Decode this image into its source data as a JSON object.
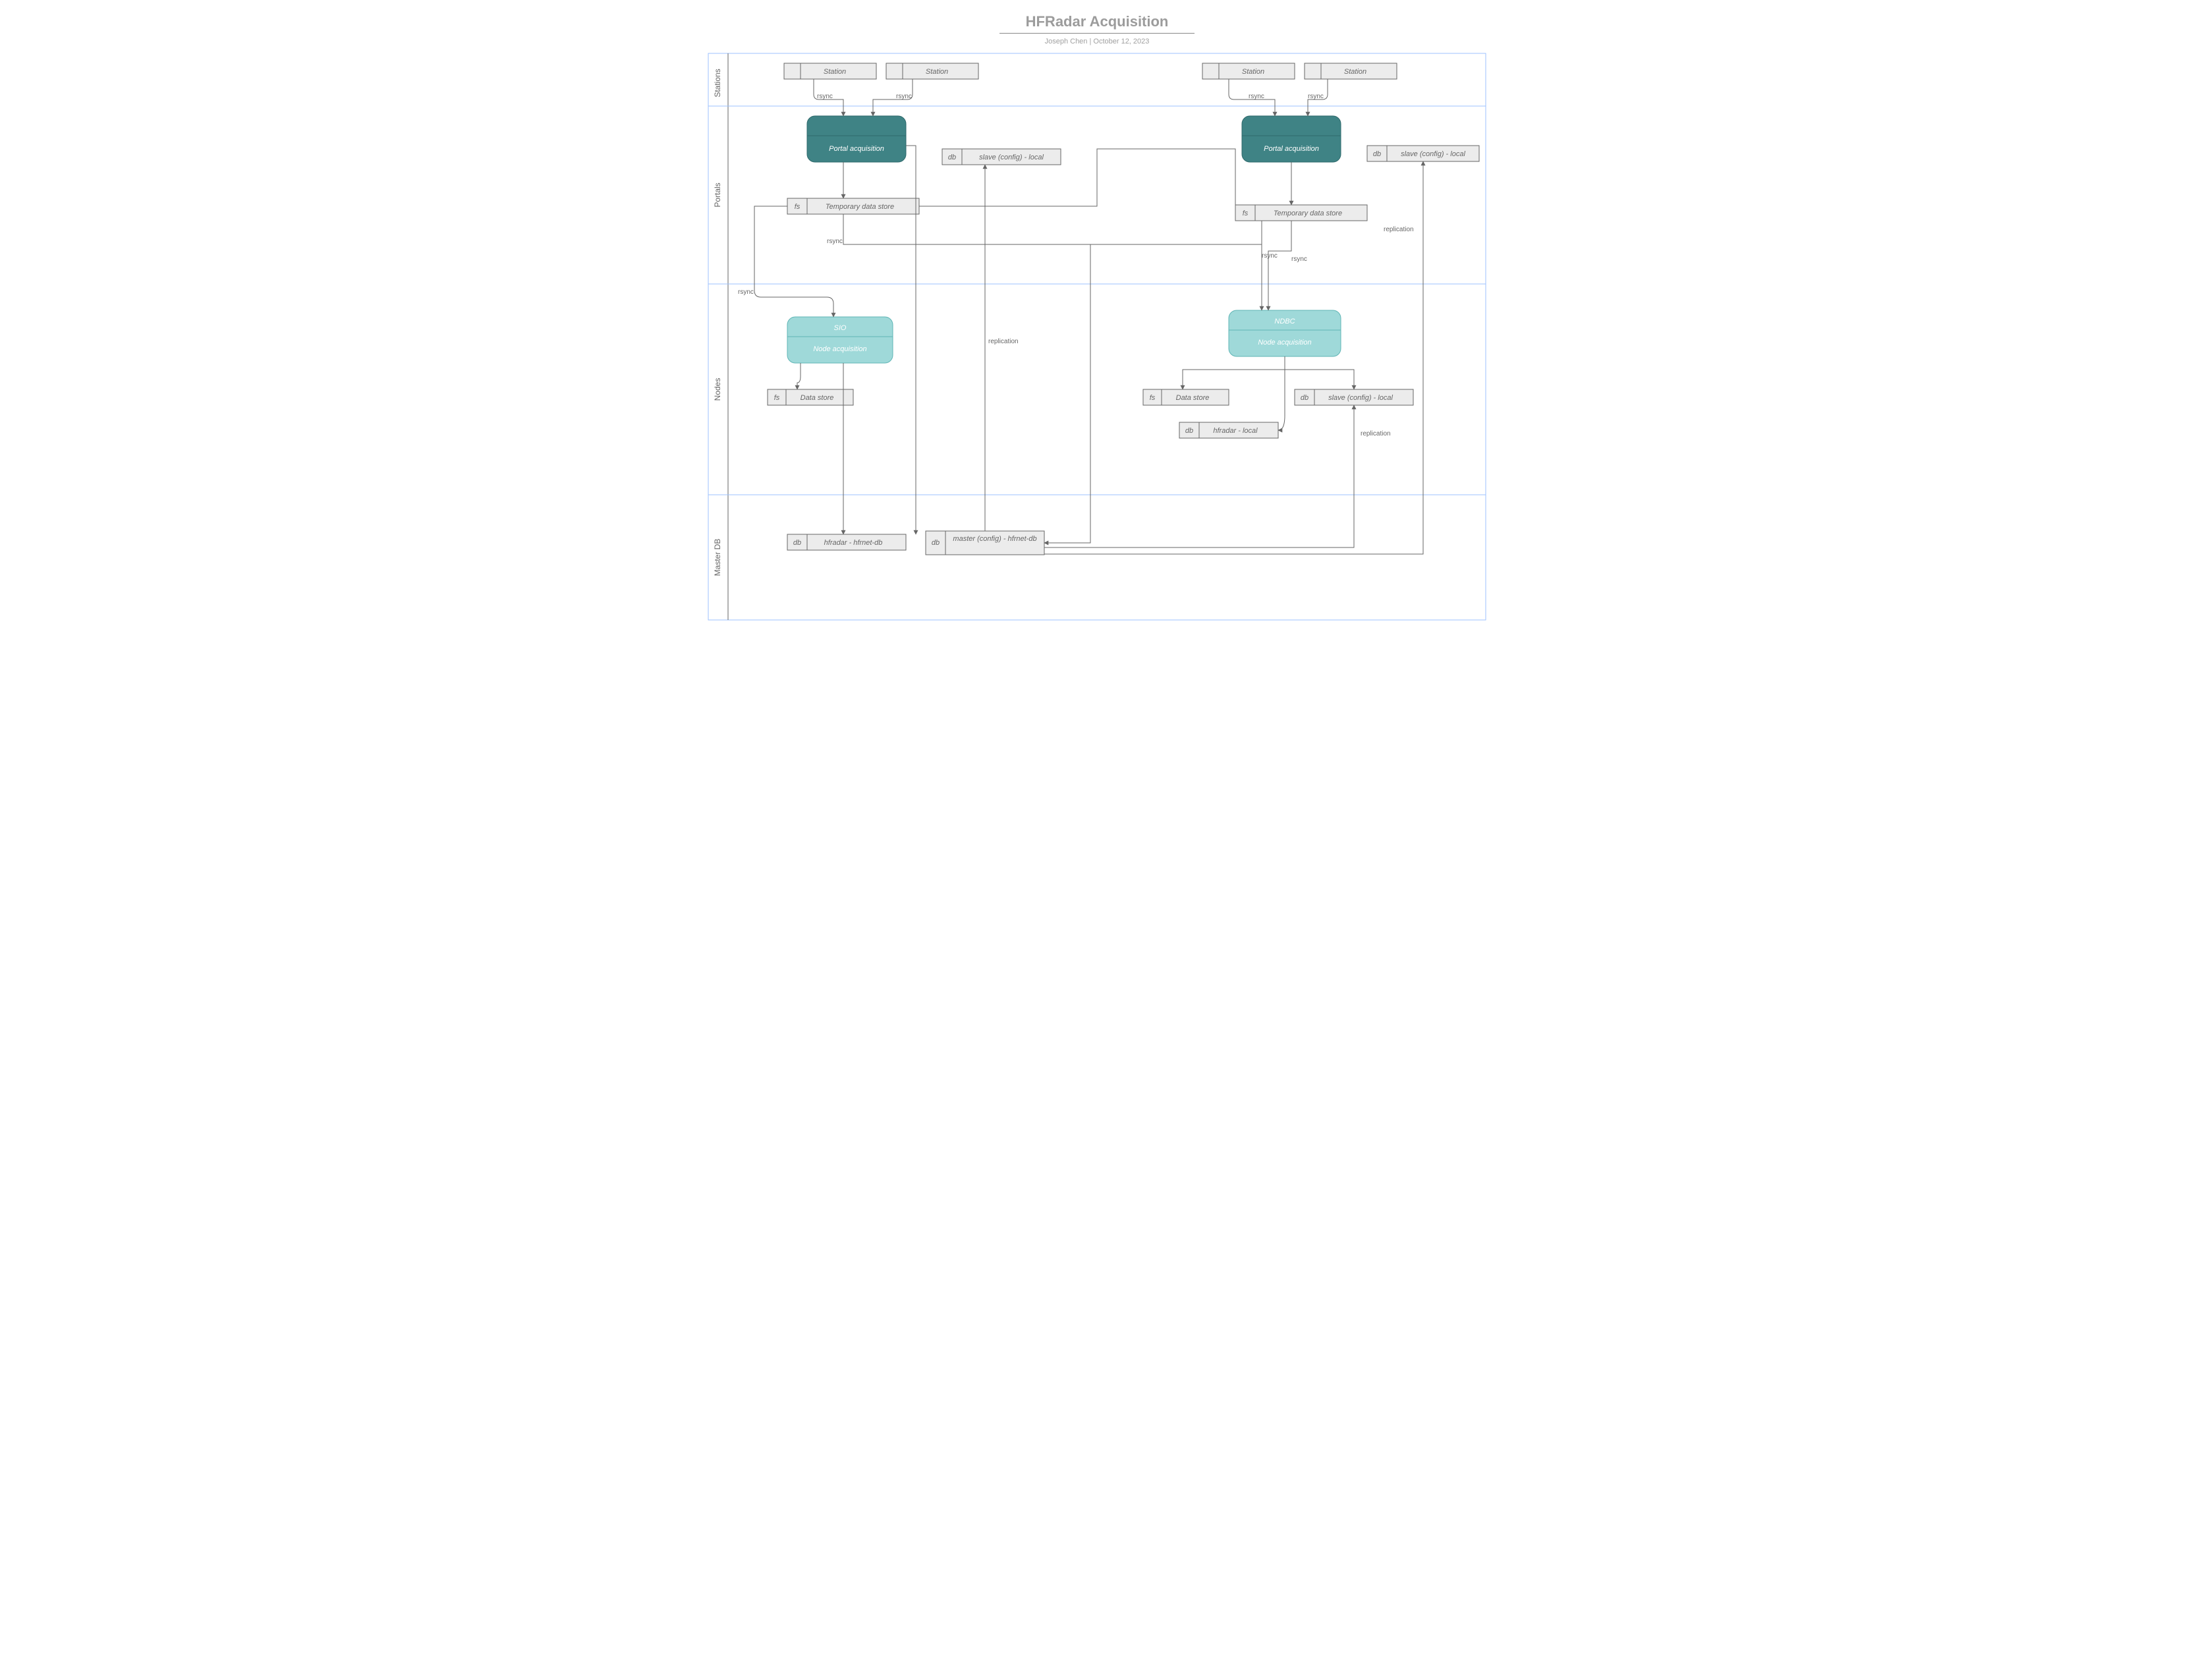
{
  "header": {
    "title": "HFRadar Acquisition",
    "subtitle": "Joseph Chen  |  October 12, 2023"
  },
  "lanes": [
    "Stations",
    "Portals",
    "Nodes",
    "Master DB"
  ],
  "nodes": {
    "st1": "Station",
    "st2": "Station",
    "st3": "Station",
    "st4": "Station",
    "pa1": "Portal acquisition",
    "pa2": "Portal acquisition",
    "tds1_tag": "fs",
    "tds1": "Temporary data store",
    "tds2_tag": "fs",
    "tds2": "Temporary data store",
    "slv1_tag": "db",
    "slv1": "slave (config) - local",
    "slv2_tag": "db",
    "slv2": "slave (config) - local",
    "sio_t": "SIO",
    "sio_b": "Node acquisition",
    "ndbc_t": "NDBC",
    "ndbc_b": "Node acquisition",
    "ds1_tag": "fs",
    "ds1": "Data store",
    "ds2_tag": "fs",
    "ds2": "Data store",
    "slv3_tag": "db",
    "slv3": "slave (config) - local",
    "hfr_tag": "db",
    "hfr": "hfradar - local",
    "m1_tag": "db",
    "m1": "hfradar - hfrnet-db",
    "m2_tag": "db",
    "m2": "master  (config) - hfrnet-db"
  },
  "edges": {
    "rsync": "rsync",
    "repl": "replication"
  }
}
